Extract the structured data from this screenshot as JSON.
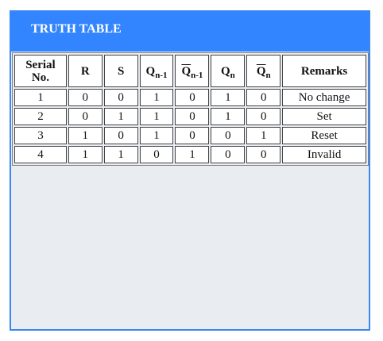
{
  "panel": {
    "title": "TRUTH TABLE"
  },
  "table": {
    "headers": {
      "serial_line1": "Serial",
      "serial_line2": "No.",
      "r": "R",
      "s": "S",
      "q_prev_base": "Q",
      "q_prev_sub": "n-1",
      "qbar_prev_base": "Q",
      "qbar_prev_sub": "n-1",
      "q_base": "Q",
      "q_sub": "n",
      "qbar_base": "Q",
      "qbar_sub": "n",
      "remarks": "Remarks"
    },
    "rows": [
      {
        "serial": "1",
        "r": "0",
        "s": "0",
        "q_prev": "1",
        "qbar_prev": "0",
        "q": "1",
        "qbar": "0",
        "remarks": "No change"
      },
      {
        "serial": "2",
        "r": "0",
        "s": "1",
        "q_prev": "1",
        "qbar_prev": "0",
        "q": "1",
        "qbar": "0",
        "remarks": "Set"
      },
      {
        "serial": "3",
        "r": "1",
        "s": "0",
        "q_prev": "1",
        "qbar_prev": "0",
        "q": "0",
        "qbar": "1",
        "remarks": "Reset"
      },
      {
        "serial": "4",
        "r": "1",
        "s": "1",
        "q_prev": "0",
        "qbar_prev": "1",
        "q": "0",
        "qbar": "0",
        "remarks": "Invalid"
      }
    ]
  }
}
